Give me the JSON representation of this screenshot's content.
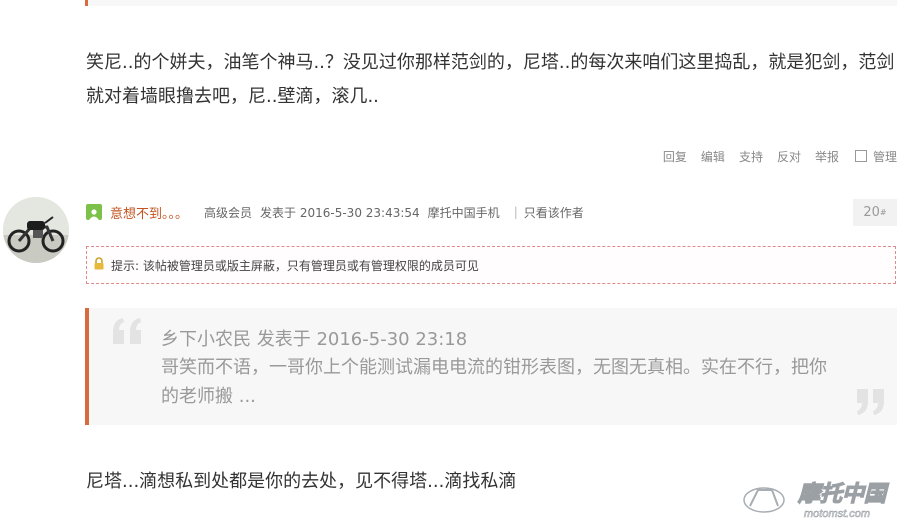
{
  "previous_post": {
    "text": "笑尼..的个姘夫，油笔个神马..？没见过你那样范剑的，尼塔..的每次来咱们这里捣乱，就是犯剑，范剑就对着墙眼撸去吧，尼..壁滴，滚几..",
    "actions": [
      "回复",
      "编辑",
      "支持",
      "反对",
      "举报"
    ],
    "manage_label": "管理"
  },
  "post": {
    "author": "意想不到。。。",
    "rank": "高级会员",
    "posted": "发表于 2016-5-30 23:43:54",
    "client": "摩托中国手机",
    "author_only": "只看该作者",
    "floor": "20",
    "floor_mark": "#",
    "notice": "提示: 该帖被管理员或版主屏蔽，只有管理员或有管理权限的成员可见",
    "quote": {
      "header": "乡下小农民 发表于 2016-5-30 23:18",
      "text": "哥笑而不语，一哥你上个能测试漏电电流的钳形表图，无图无真相。实在不行，把你的老师搬 ..."
    },
    "text": "尼塔...滴想私到处都是你的去处，见不得塔...滴找私滴"
  },
  "watermark": {
    "brand": "摩托中国",
    "url": "motomst.com"
  },
  "colors": {
    "accent": "#d86a3c",
    "author_name": "#c2541f",
    "user_icon": "#7cc24a",
    "notice_border": "#e08b8b"
  }
}
